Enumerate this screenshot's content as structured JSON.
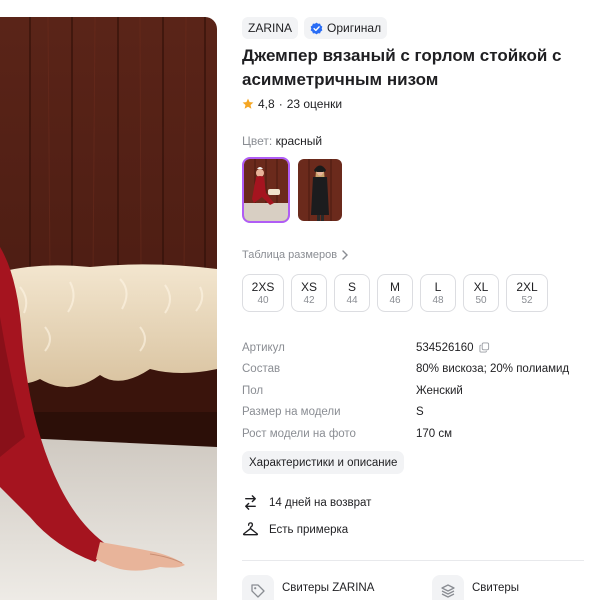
{
  "product": {
    "brand": "ZARINA",
    "original_badge": "Оригинал",
    "title": "Джемпер вязаный с горлом стойкой с асимметричным низом",
    "rating": "4,8",
    "reviews": "23 оценки",
    "color_prefix": "Цвет:",
    "color_value": "красный",
    "size_table_link": "Таблица размеров",
    "sizes": [
      {
        "name": "2XS",
        "ru": "40"
      },
      {
        "name": "XS",
        "ru": "42"
      },
      {
        "name": "S",
        "ru": "44"
      },
      {
        "name": "M",
        "ru": "46"
      },
      {
        "name": "L",
        "ru": "48"
      },
      {
        "name": "XL",
        "ru": "50"
      },
      {
        "name": "2XL",
        "ru": "52"
      }
    ],
    "specs": [
      {
        "key": "Артикул",
        "value": "534526160"
      },
      {
        "key": "Состав",
        "value": "80% вискоза; 20% полиамид"
      },
      {
        "key": "Пол",
        "value": "Женский"
      },
      {
        "key": "Размер на модели",
        "value": "S"
      },
      {
        "key": "Рост модели на фото",
        "value": "170 см"
      }
    ],
    "characteristics_button": "Характеристики и описание",
    "perks": {
      "return": "14 дней на возврат",
      "fitting": "Есть примерка"
    },
    "categories": [
      "Свитеры ZARINA",
      "Свитеры"
    ]
  },
  "colors": {
    "accent_selected": "#b05cf5",
    "verified_badge": "#2a6df5",
    "rating_star": "#f5a623",
    "sweater_red": "#a5141f"
  },
  "icons": {
    "verified": "check-badge-icon",
    "rating": "star-icon",
    "copy": "copy-icon",
    "return": "return-arrows-icon",
    "fitting": "hanger-icon",
    "category_brand": "tag-icon",
    "category": "layers-icon"
  }
}
